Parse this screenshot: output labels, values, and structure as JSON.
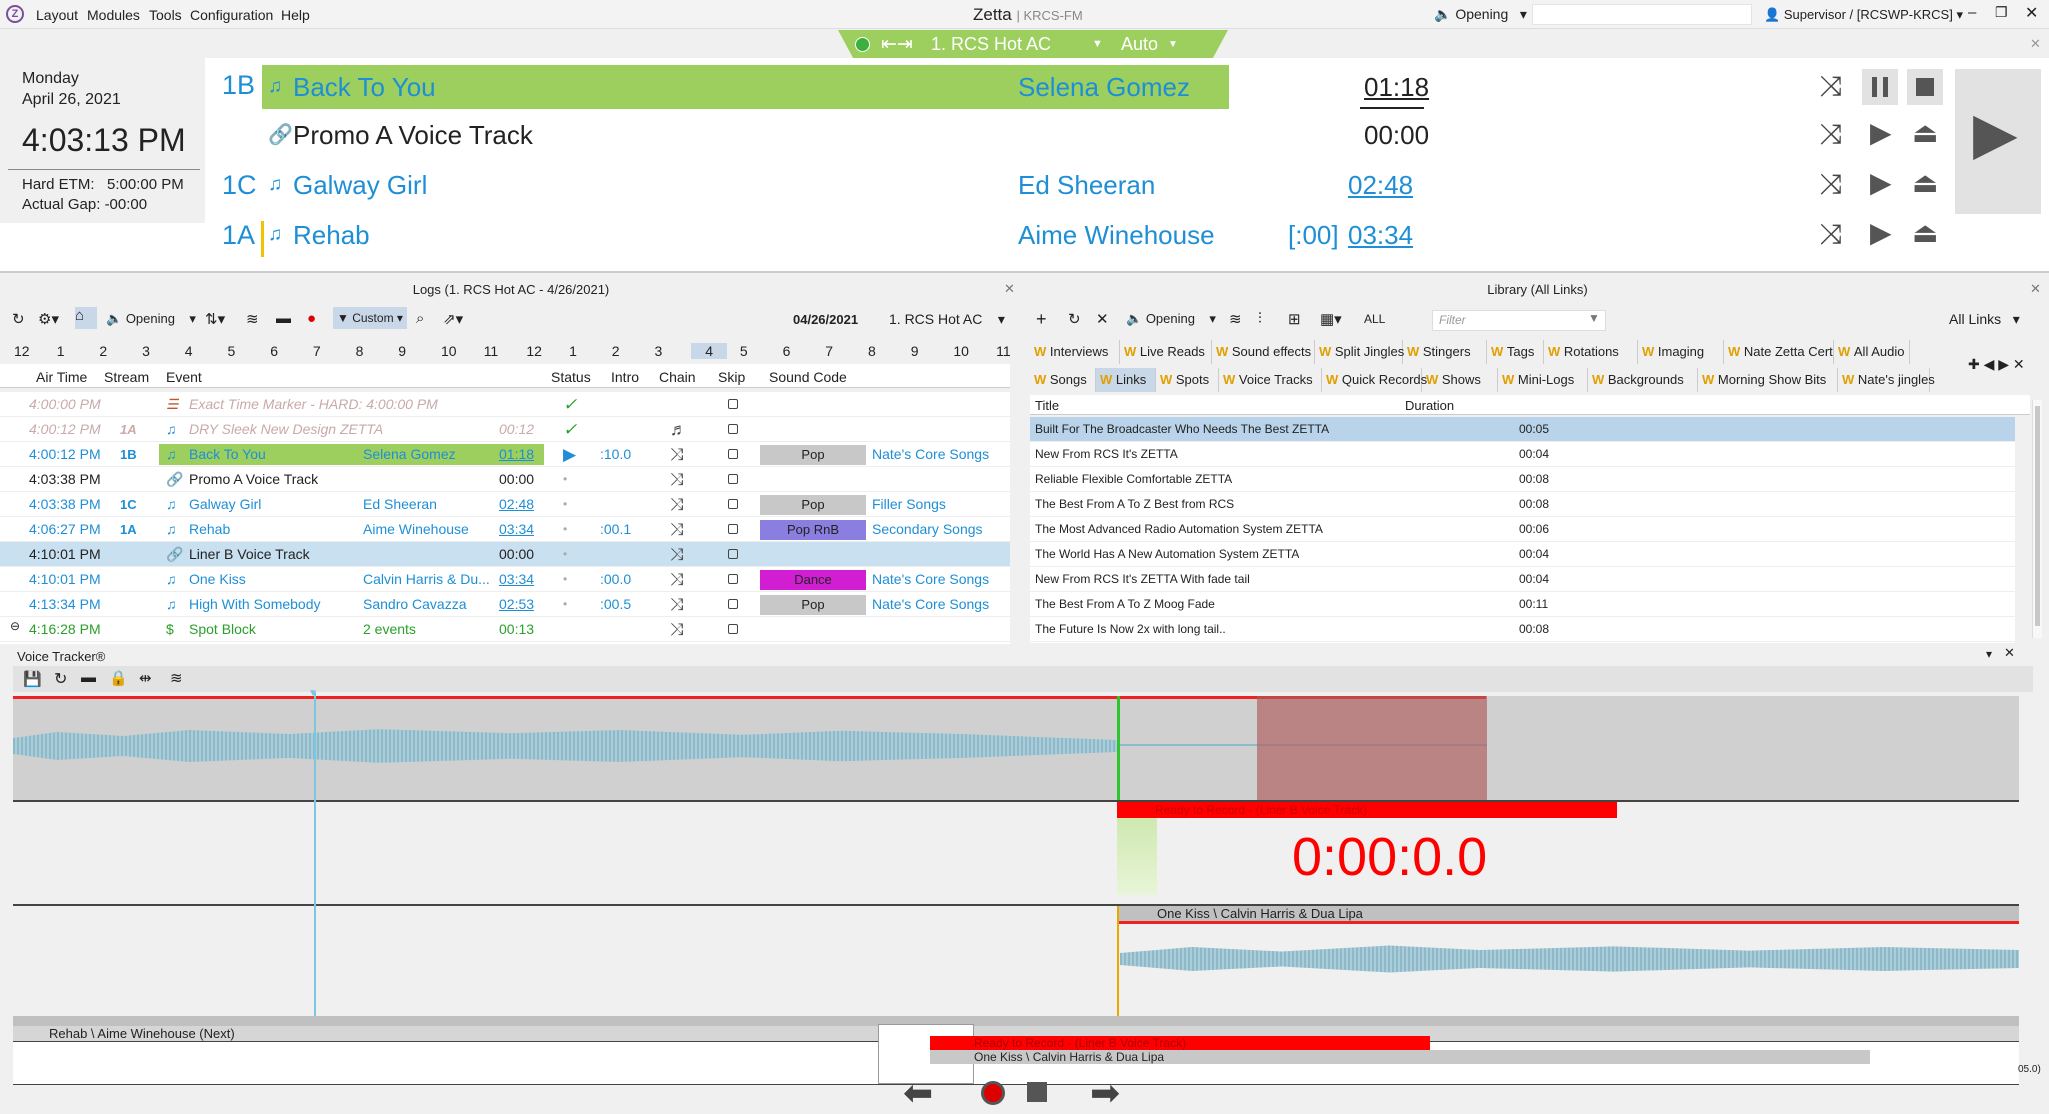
{
  "menubar": {
    "logo": "Z",
    "items": [
      "Layout",
      "Modules",
      "Tools",
      "Configuration",
      "Help"
    ],
    "app": "Zetta",
    "station": "KRCS-FM",
    "opening": "Opening",
    "user": "Supervisor / [RCSWP-KRCS]"
  },
  "control": {
    "station": "1. RCS Hot AC",
    "mode": "Auto"
  },
  "clock": {
    "day": "Monday",
    "date": "April 26, 2021",
    "time": "4:03:13 PM",
    "etm_label": "Hard ETM:",
    "etm": "5:00:00 PM",
    "gap_label": "Actual Gap:",
    "gap": "-00:00"
  },
  "onair": [
    {
      "stream": "1B",
      "title": "Back To You",
      "artist": "Selena Gomez",
      "time": "01:18",
      "intro": ""
    },
    {
      "stream": "",
      "title": "Promo A Voice Track",
      "artist": "",
      "time": "00:00",
      "intro": ""
    },
    {
      "stream": "1C",
      "title": "Galway Girl",
      "artist": "Ed Sheeran",
      "time": "02:48",
      "intro": ""
    },
    {
      "stream": "1A",
      "title": "Rehab",
      "artist": "Aime Winehouse",
      "time": "03:34",
      "intro": "[:00]"
    }
  ],
  "logs": {
    "title": "Logs (1. RCS Hot AC - 4/26/2021)",
    "opening": "Opening",
    "filter": "Custom",
    "date": "04/26/2021",
    "station": "1. RCS Hot AC",
    "hours": [
      "12",
      "1",
      "2",
      "3",
      "4",
      "5",
      "6",
      "7",
      "8",
      "9",
      "10",
      "11",
      "12",
      "1",
      "2",
      "3",
      "4",
      "5",
      "6",
      "7",
      "8",
      "9",
      "10",
      "11"
    ],
    "columns": [
      "Air Time",
      "Stream",
      "Event",
      "Status",
      "Intro",
      "Chain",
      "Skip",
      "Sound Code"
    ],
    "rows": [
      {
        "time": "4:00:00 PM",
        "stream": "",
        "event": "Exact Time Marker - HARD: 4:00:00 PM",
        "artist": "",
        "dur": "",
        "status": "✓",
        "intro": "",
        "code": "",
        "cat": ""
      },
      {
        "time": "4:00:12 PM",
        "stream": "1A",
        "event": "DRY Sleek New Design ZETTA",
        "artist": "",
        "dur": "00:12",
        "status": "✓",
        "intro": "",
        "code": "",
        "cat": ""
      },
      {
        "time": "4:00:12 PM",
        "stream": "1B",
        "event": "Back To You",
        "artist": "Selena Gomez",
        "dur": "01:18",
        "status": "▶",
        "intro": ":10.0",
        "code": "Pop",
        "cat": "Nate's Core Songs"
      },
      {
        "time": "4:03:38 PM",
        "stream": "",
        "event": "Promo A Voice Track",
        "artist": "",
        "dur": "00:00",
        "status": "•",
        "intro": "",
        "code": "",
        "cat": ""
      },
      {
        "time": "4:03:38 PM",
        "stream": "1C",
        "event": "Galway Girl",
        "artist": "Ed Sheeran",
        "dur": "02:48",
        "status": "•",
        "intro": "",
        "code": "Pop",
        "cat": "Filler Songs"
      },
      {
        "time": "4:06:27 PM",
        "stream": "1A",
        "event": "Rehab",
        "artist": "Aime Winehouse",
        "dur": "03:34",
        "status": "•",
        "intro": ":00.1",
        "code": "Pop RnB",
        "cat": "Secondary Songs"
      },
      {
        "time": "4:10:01 PM",
        "stream": "",
        "event": "Liner B Voice Track",
        "artist": "",
        "dur": "00:00",
        "status": "•",
        "intro": "",
        "code": "",
        "cat": ""
      },
      {
        "time": "4:10:01 PM",
        "stream": "",
        "event": "One Kiss",
        "artist": "Calvin Harris & Du...",
        "dur": "03:34",
        "status": "•",
        "intro": ":00.0",
        "code": "Dance",
        "cat": "Nate's Core Songs"
      },
      {
        "time": "4:13:34 PM",
        "stream": "",
        "event": "High With Somebody",
        "artist": "Sandro Cavazza",
        "dur": "02:53",
        "status": "•",
        "intro": ":00.5",
        "code": "Pop",
        "cat": "Nate's Core Songs"
      },
      {
        "time": "4:16:28 PM",
        "stream": "",
        "event": "Spot Block",
        "artist": "2 events",
        "dur": "00:13",
        "status": "",
        "intro": "",
        "code": "",
        "cat": ""
      }
    ]
  },
  "library": {
    "title": "Library (All Links)",
    "opening": "Opening",
    "all": "ALL",
    "filter_placeholder": "Filter",
    "scope": "All Links",
    "tabs1": [
      "Interviews",
      "Live Reads",
      "Sound effects",
      "Split Jingles",
      "Stingers",
      "Tags",
      "Rotations",
      "Imaging",
      "Nate Zetta Cert",
      "All Audio"
    ],
    "tabs2": [
      "Songs",
      "Links",
      "Spots",
      "Voice Tracks",
      "Quick Records",
      "Shows",
      "Mini-Logs",
      "Backgrounds",
      "Morning Show Bits",
      "Nate's jingles"
    ],
    "columns": [
      "Title",
      "Duration"
    ],
    "rows": [
      {
        "title": "Built For The Broadcaster Who Needs The Best ZETTA",
        "dur": "00:05"
      },
      {
        "title": "New From RCS It's ZETTA",
        "dur": "00:04"
      },
      {
        "title": "Reliable Flexible Comfortable ZETTA",
        "dur": "00:08"
      },
      {
        "title": "The Best From A To  Z Best from RCS",
        "dur": "00:08"
      },
      {
        "title": "The Most Advanced Radio Automation System ZETTA",
        "dur": "00:06"
      },
      {
        "title": "The World Has A New Automation System ZETTA",
        "dur": "00:04"
      },
      {
        "title": "New From RCS It's ZETTA With fade tail",
        "dur": "00:04"
      },
      {
        "title": "The Best From A To Z Moog Fade",
        "dur": "00:11"
      },
      {
        "title": "The Future Is Now 2x with long tail..",
        "dur": "00:08"
      }
    ]
  },
  "vt": {
    "title": "Voice Tracker®",
    "ready": "Ready to Record - (Liner B Voice Track)",
    "timer": "0:00:0.0",
    "next_track": "One Kiss \\ Calvin Harris & Dua Lipa",
    "prev_track": "Rehab \\ Aime Winehouse (Next)",
    "mini_ready": "Ready to Record - (Liner B Voice Track)",
    "mini_next": "One Kiss \\ Calvin Harris & Dua Lipa",
    "end_time": "05.0)"
  },
  "colors": {
    "green": "#9ccf5e",
    "blue": "#1e8fd6",
    "red": "#ff0000",
    "pop": "#c8c8c8",
    "poprnb": "#8a7fe0",
    "dance": "#d21ed2"
  }
}
